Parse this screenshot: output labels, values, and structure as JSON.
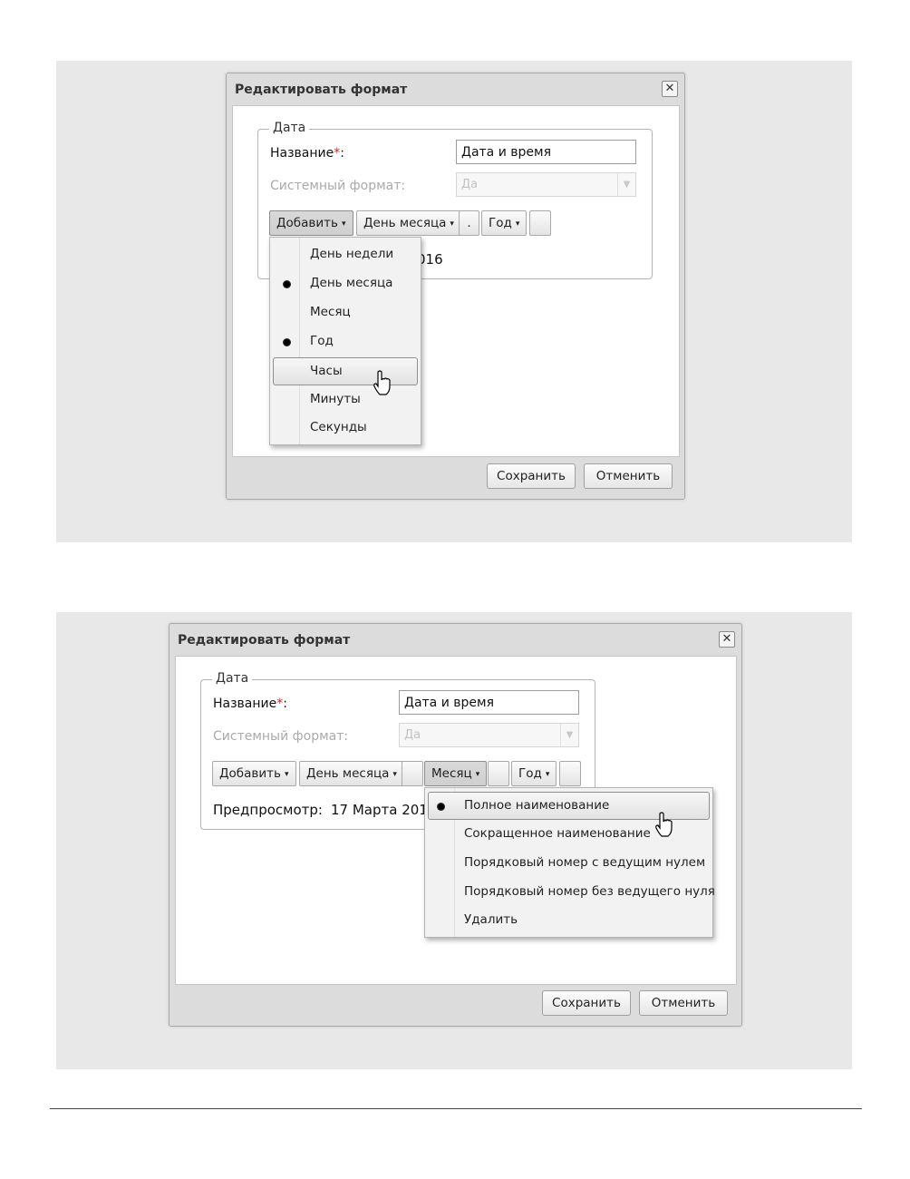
{
  "screens": [
    {
      "dialog": {
        "title": "Редактировать формат",
        "close_symbol": "✕",
        "fieldset_legend": "Дата",
        "name_label": "Название",
        "required_mark": "*",
        "name_colon": ":",
        "name_value": "Дата и время",
        "system_format_label": "Системный формат:",
        "system_format_value": "Да",
        "toolbar": [
          {
            "label": "Добавить",
            "dropdown": true
          },
          {
            "label": "День месяца",
            "dropdown": true
          },
          {
            "label": ".",
            "dropdown": false
          },
          {
            "label": "Год",
            "dropdown": true
          },
          {
            "label": "",
            "dropdown": false
          }
        ],
        "preview_visible_fragment": "016",
        "menu": {
          "items": [
            {
              "label": "День недели",
              "checked": false,
              "highlighted": false
            },
            {
              "label": "День месяца",
              "checked": true,
              "highlighted": false
            },
            {
              "label": "Месяц",
              "checked": false,
              "highlighted": false
            },
            {
              "label": "Год",
              "checked": true,
              "highlighted": false
            },
            {
              "label": "Часы",
              "checked": false,
              "highlighted": true
            },
            {
              "label": "Минуты",
              "checked": false,
              "highlighted": false
            },
            {
              "label": "Секунды",
              "checked": false,
              "highlighted": false
            }
          ]
        },
        "save_label": "Сохранить",
        "cancel_label": "Отменить"
      }
    },
    {
      "dialog": {
        "title": "Редактировать формат",
        "close_symbol": "✕",
        "fieldset_legend": "Дата",
        "name_label": "Название",
        "required_mark": "*",
        "name_colon": ":",
        "name_value": "Дата и время",
        "system_format_label": "Системный формат:",
        "system_format_value": "Да",
        "toolbar": [
          {
            "label": "Добавить",
            "dropdown": true
          },
          {
            "label": "День месяца",
            "dropdown": true
          },
          {
            "label": "",
            "dropdown": false
          },
          {
            "label": "Месяц",
            "dropdown": true
          },
          {
            "label": "",
            "dropdown": false
          },
          {
            "label": "Год",
            "dropdown": true
          },
          {
            "label": "",
            "dropdown": false
          }
        ],
        "preview_label": "Предпросмотр:",
        "preview_value": "17 Марта 201",
        "menu": {
          "items": [
            {
              "label": "Полное наименование",
              "checked": true,
              "highlighted": true
            },
            {
              "label": "Сокращенное наименование",
              "checked": false,
              "highlighted": false
            },
            {
              "label": "Порядковый номер с ведущим нулем",
              "checked": false,
              "highlighted": false
            },
            {
              "label": "Порядковый номер без ведущего нуля",
              "checked": false,
              "highlighted": false
            },
            {
              "label": "Удалить",
              "checked": false,
              "highlighted": false
            }
          ]
        },
        "save_label": "Сохранить",
        "cancel_label": "Отменить"
      }
    }
  ],
  "icons": {
    "caret": "▾",
    "dropdown_trigger": "chevron-down-icon",
    "close": "close-icon",
    "radio_dot": "radio-dot-icon",
    "pointer": "hand-cursor-icon"
  },
  "colors": {
    "panel_bg": "#e8e8e8",
    "dialog_bg": "#dcdcdc",
    "required": "#dd2222",
    "disabled_text": "#aaaaaa"
  }
}
